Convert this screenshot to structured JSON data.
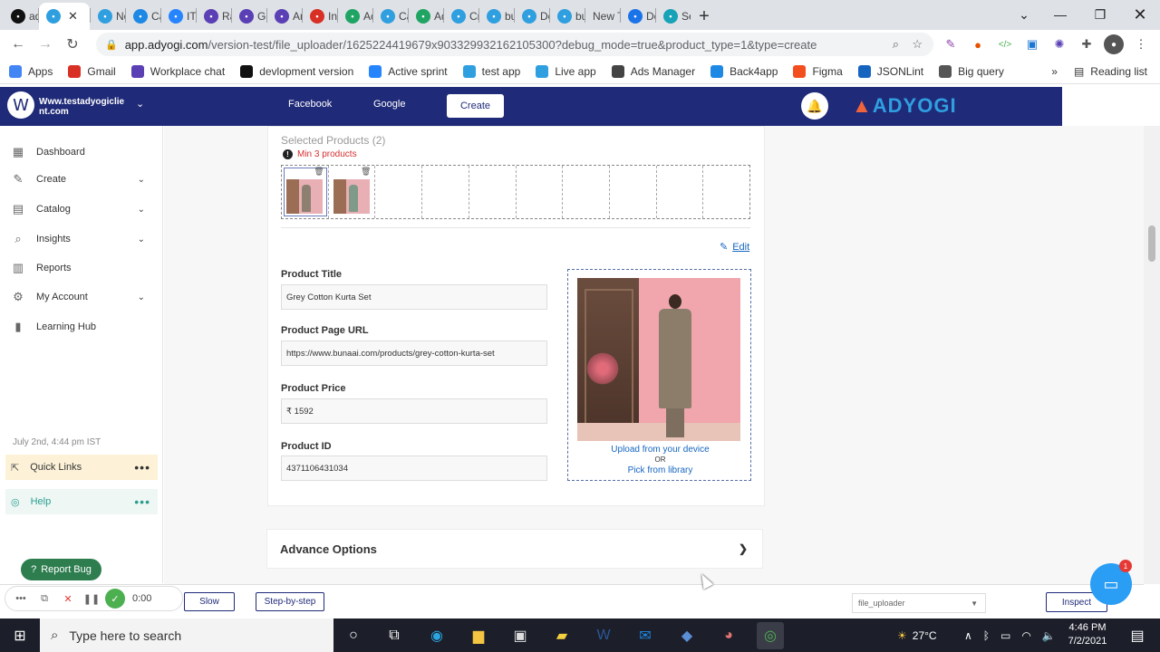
{
  "browser": {
    "tabs": [
      {
        "label": "adc",
        "icon": "b-icon",
        "color": "#111111"
      },
      {
        "label": "",
        "icon": "adyogi-icon",
        "color": "#2f9fe0",
        "active": true
      },
      {
        "label": "No",
        "icon": "adyogi-icon",
        "color": "#2f9fe0"
      },
      {
        "label": "Car",
        "icon": "back4app-icon",
        "color": "#1e88e5"
      },
      {
        "label": "IT b",
        "icon": "jira-icon",
        "color": "#2684ff"
      },
      {
        "label": "Rai",
        "icon": "workplace-icon",
        "color": "#5b3fb5"
      },
      {
        "label": "Go",
        "icon": "gear-icon",
        "color": "#5b3fb5"
      },
      {
        "label": "An",
        "icon": "workplace-icon",
        "color": "#5b3fb5"
      },
      {
        "label": "Inb",
        "icon": "gmail-icon",
        "color": "#d93025"
      },
      {
        "label": "Acc",
        "icon": "drive-icon",
        "color": "#1fa463"
      },
      {
        "label": "Car",
        "icon": "adyogi-icon",
        "color": "#2f9fe0"
      },
      {
        "label": "Ad",
        "icon": "drive-icon",
        "color": "#1fa463"
      },
      {
        "label": "Cre",
        "icon": "adyogi-icon",
        "color": "#2f9fe0"
      },
      {
        "label": "but",
        "icon": "adyogi-icon",
        "color": "#2f9fe0"
      },
      {
        "label": "Do",
        "icon": "adyogi-icon",
        "color": "#2f9fe0"
      },
      {
        "label": "but",
        "icon": "adyogi-icon",
        "color": "#2f9fe0"
      },
      {
        "label": "New Ta",
        "icon": "",
        "color": ""
      },
      {
        "label": "Do",
        "icon": "download-icon",
        "color": "#1a73e8"
      },
      {
        "label": "Sea",
        "icon": "z-icon",
        "color": "#17a2b8"
      }
    ],
    "url_main": "app.adyogi.com",
    "url_tail": "/version-test/file_uploader/1625224419679x903329932162105300?debug_mode=true&product_type=1&type=create",
    "bookmarks": [
      {
        "label": "Apps",
        "icon": "apps-grid-icon",
        "color": "#4285f4"
      },
      {
        "label": "Gmail",
        "icon": "gmail-icon",
        "color": "#d93025"
      },
      {
        "label": "Workplace chat",
        "icon": "workplace-icon",
        "color": "#5b3fb5"
      },
      {
        "label": "devlopment version",
        "icon": "b-icon",
        "color": "#111111"
      },
      {
        "label": "Active sprint",
        "icon": "jira-icon",
        "color": "#2684ff"
      },
      {
        "label": "test app",
        "icon": "adyogi-icon",
        "color": "#2f9fe0"
      },
      {
        "label": "Live app",
        "icon": "adyogi-icon",
        "color": "#2f9fe0"
      },
      {
        "label": "Ads Manager",
        "icon": "ads-manager-icon",
        "color": "#444444"
      },
      {
        "label": "Back4app",
        "icon": "back4app-icon",
        "color": "#1e88e5"
      },
      {
        "label": "Figma",
        "icon": "figma-icon",
        "color": "#f24e1e"
      },
      {
        "label": "JSONLint",
        "icon": "jsonlint-icon",
        "color": "#1565c0"
      },
      {
        "label": "Big query",
        "icon": "bigquery-icon",
        "color": "#555555"
      }
    ],
    "reading_list": "Reading list"
  },
  "app": {
    "brand_initial": "W",
    "brand_name": "Www.testadyogiclie nt.com",
    "nav": {
      "facebook": "Facebook",
      "google": "Google",
      "create": "Create"
    },
    "logo_text": "ADYOGI",
    "sidebar": {
      "items": [
        {
          "label": "Dashboard",
          "icon": "dashboard-icon",
          "has_chevron": false
        },
        {
          "label": "Create",
          "icon": "create-icon",
          "has_chevron": true
        },
        {
          "label": "Catalog",
          "icon": "catalog-icon",
          "has_chevron": true
        },
        {
          "label": "Insights",
          "icon": "insights-icon",
          "has_chevron": true
        },
        {
          "label": "Reports",
          "icon": "reports-icon",
          "has_chevron": false
        },
        {
          "label": "My Account",
          "icon": "gear-icon",
          "has_chevron": true
        },
        {
          "label": "Learning Hub",
          "icon": "learning-hub-icon",
          "has_chevron": false
        }
      ],
      "date": "July 2nd, 4:44 pm IST",
      "quick_links": "Quick Links",
      "help": "Help",
      "report_bug": "Report Bug"
    },
    "product": {
      "selected_title": "Selected Products (2)",
      "min_warning": "Min 3 products",
      "edit": "Edit",
      "fields": [
        {
          "label": "Product Title",
          "value": "Grey Cotton Kurta Set"
        },
        {
          "label": "Product Page URL",
          "value": "https://www.bunaai.com/products/grey-cotton-kurta-set"
        },
        {
          "label": "Product Price",
          "value": "₹ 1592"
        },
        {
          "label": "Product ID",
          "value": "4371106431034"
        }
      ],
      "upload_device": "Upload from your device",
      "upload_or": "OR",
      "upload_library": "Pick from library"
    },
    "advance_options": "Advance Options"
  },
  "debug": {
    "speed_slow": "Slow",
    "step_by_step": "Step-by-step",
    "file_select": "file_uploader",
    "inspect": "Inspect",
    "chat_badge": "1"
  },
  "recorder": {
    "timer": "0:00"
  },
  "taskbar": {
    "search_placeholder": "Type here to search",
    "temperature": "27°C",
    "time": "4:46 PM",
    "date": "7/2/2021"
  }
}
